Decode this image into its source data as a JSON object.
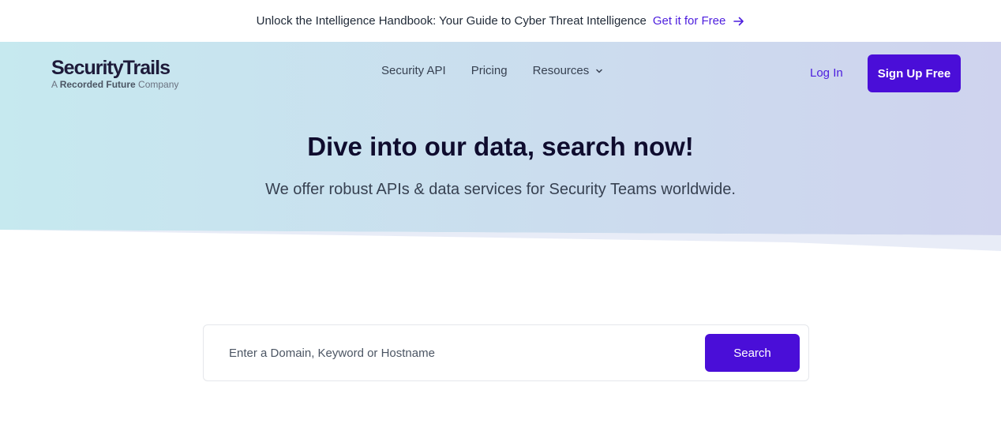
{
  "announcement": {
    "text": "Unlock the Intelligence Handbook: Your Guide to Cyber Threat Intelligence",
    "link_label": "Get it for Free",
    "link_icon": "arrow-right-icon"
  },
  "header": {
    "logo": {
      "name": "SecurityTrails",
      "tagline_prefix": "A",
      "tagline_brand": "Recorded Future",
      "tagline_suffix": "Company"
    },
    "nav": [
      {
        "label": "Security API"
      },
      {
        "label": "Pricing"
      },
      {
        "label": "Resources",
        "icon": "chevron-down-icon"
      }
    ],
    "login_label": "Log In",
    "signup_label": "Sign Up Free"
  },
  "hero": {
    "title": "Dive into our data, search now!",
    "subtitle": "We offer robust APIs & data services for Security Teams worldwide."
  },
  "search": {
    "placeholder": "Enter a Domain, Keyword or Hostname",
    "value": "",
    "button_label": "Search"
  },
  "colors": {
    "accent": "#4a0ed8",
    "link": "#4c1dde",
    "hero_gradient_start": "#c6e9ef",
    "hero_gradient_end": "#cfd3ee",
    "title": "#0f0c2e"
  }
}
